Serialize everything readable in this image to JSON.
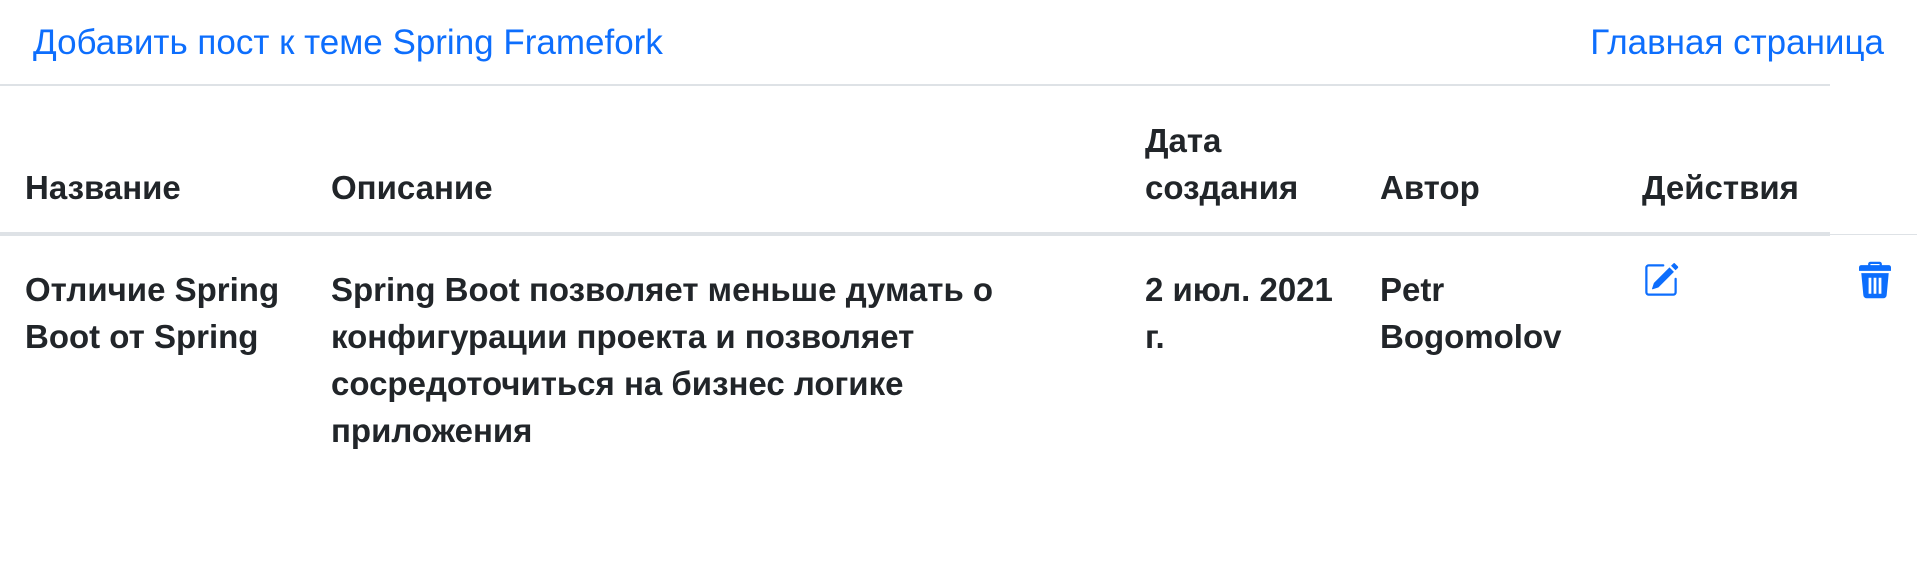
{
  "nav": {
    "add_post_link": "Добавить пост к теме Spring Framefork",
    "home_link": "Главная страница"
  },
  "table": {
    "headers": {
      "title": "Название",
      "description": "Описание",
      "date": "Дата создания",
      "author": "Автор",
      "actions": "Действия"
    },
    "rows": [
      {
        "title": "Отличие Spring Boot от Spring",
        "description": "Spring Boot позволяет меньше думать о конфигурации проекта и позволяет сосредоточиться на бизнес логике приложения",
        "date": "2 июл. 2021 г.",
        "author": "Petr Bogomolov",
        "actions": {
          "edit_icon": "edit-icon",
          "delete_icon": "trash-icon"
        }
      }
    ]
  },
  "colors": {
    "link": "#0d6efd",
    "text": "#212529",
    "divider": "#dee2e6"
  }
}
